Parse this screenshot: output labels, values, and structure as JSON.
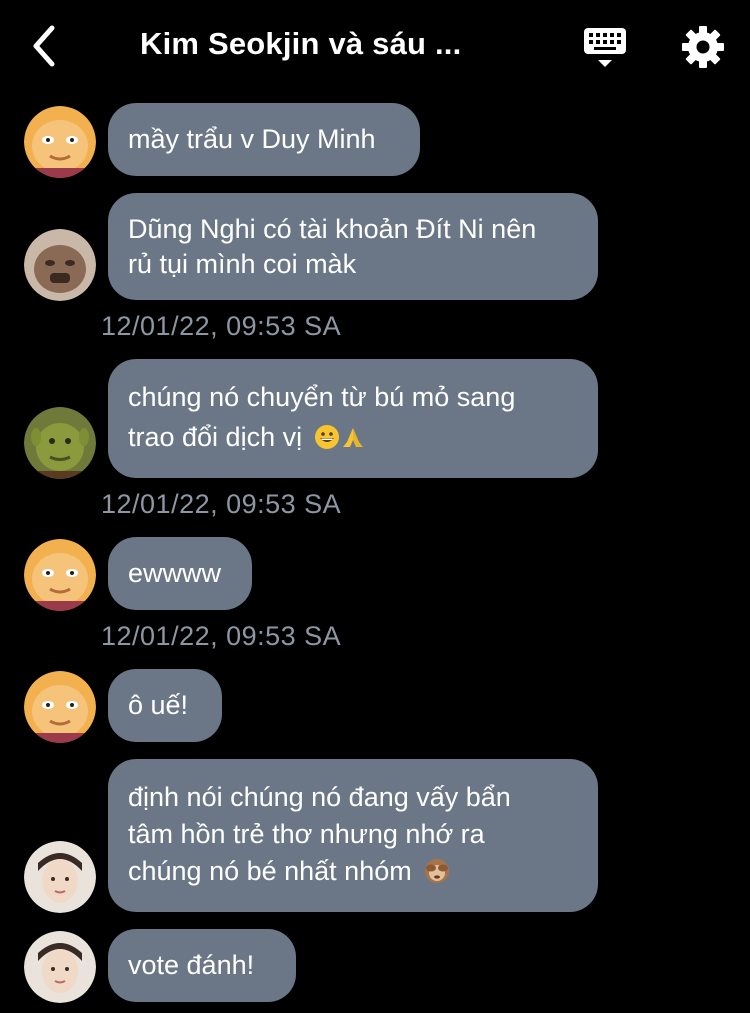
{
  "header": {
    "title": "Kim Seokjin và sáu ...",
    "back_icon": "chevron-left-icon",
    "keyboard_icon": "keyboard-icon",
    "settings_icon": "gear-icon"
  },
  "messages": [
    {
      "text": "mầy trẩu v Duy Minh",
      "avatar": "face-avatar-orange"
    },
    {
      "lines": [
        "Dũng Nghi có tài khoản Đít Ni nên",
        "rủ tụi mình coi màk"
      ],
      "avatar": "face-avatar-brown"
    },
    {
      "timestamp": "12/01/22, 09:53 SA"
    },
    {
      "lines": [
        "chúng nó chuyển từ bú mỏ sang",
        "trao đổi dịch vị"
      ],
      "avatar": "face-avatar-green",
      "emojis": [
        "grinning-face-icon",
        "praying-hands-icon"
      ]
    },
    {
      "timestamp": "12/01/22, 09:53 SA"
    },
    {
      "text": "ewwww",
      "avatar": "face-avatar-orange"
    },
    {
      "timestamp": "12/01/22, 09:53 SA"
    },
    {
      "text": "ô uế!",
      "avatar": "face-avatar-orange"
    },
    {
      "lines": [
        "định nói chúng nó đang vấy bẩn",
        "tâm hồn trẻ thơ nhưng nhớ ra",
        "chúng nó bé nhất nhóm"
      ],
      "avatar": "photo-avatar-person",
      "emojis": [
        "see-no-evil-monkey-icon"
      ]
    },
    {
      "text": "vote đánh!",
      "avatar": "photo-avatar-person"
    }
  ],
  "colors": {
    "background": "#000000",
    "bubble": "#6b7786",
    "timestamp": "#8d97a4"
  }
}
